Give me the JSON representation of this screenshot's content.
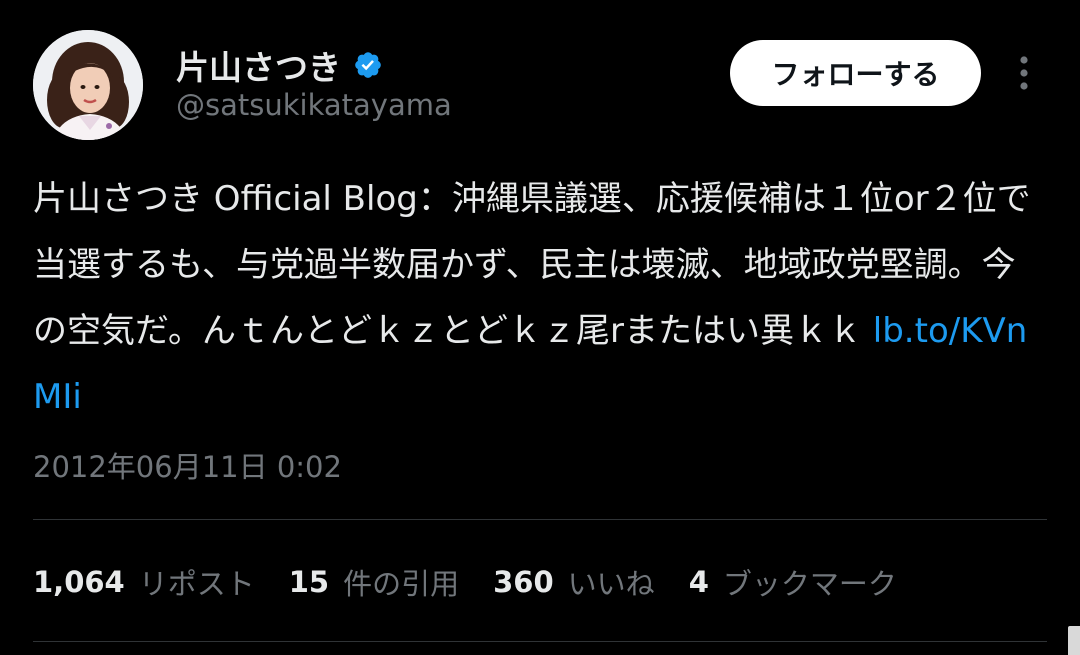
{
  "user": {
    "display_name": "片山さつき",
    "handle": "@satsukikatayama",
    "avatar_icon": "avatar-photo",
    "verified_color": "#1d9bf0"
  },
  "follow_button": {
    "label": "フォローする"
  },
  "more_button": {
    "icon": "more-vertical-icon"
  },
  "tweet": {
    "text": "片山さつき Official Blog：沖縄県議選、応援候補は１位or２位で当選するも、与党過半数届かず、民主は壊滅、地域政党堅調。今の空気だ。んｔんとどｋｚとどｋｚ尾rまたはい異ｋｋ",
    "link": "lb.to/KVnMIi",
    "link_color": "#1d9bf0"
  },
  "timestamp": "2012年06月11日 0:02",
  "stats": {
    "reposts": {
      "count": "1,064",
      "label": "リポスト"
    },
    "quotes": {
      "count": "15",
      "label": "件の引用"
    },
    "likes": {
      "count": "360",
      "label": "いいね"
    },
    "bookmarks": {
      "count": "4",
      "label": "ブックマーク"
    }
  }
}
